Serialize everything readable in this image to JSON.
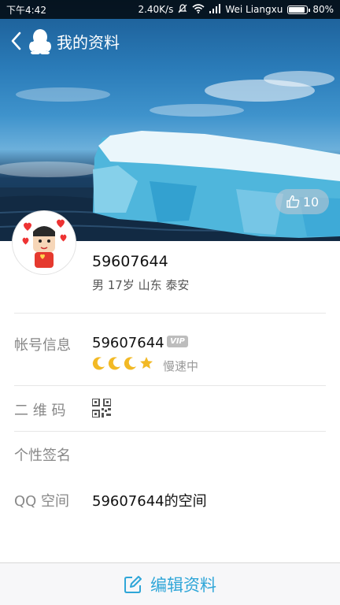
{
  "status_bar": {
    "time": "下午4:42",
    "network_speed": "2.40K/s",
    "carrier": "Wei Liangxu",
    "battery": "80%"
  },
  "header": {
    "title": "我的资料"
  },
  "cover": {
    "like_count": "10"
  },
  "profile": {
    "name": "59607644",
    "info": "男 17岁 山东 泰安"
  },
  "details": {
    "account": {
      "label": "帐号信息",
      "value": "59607644",
      "vip_badge": "VIP",
      "speed": "慢速中"
    },
    "qrcode": {
      "label": "二 维 码"
    },
    "signature": {
      "label": "个性签名",
      "value": ""
    },
    "qzone": {
      "label": "QQ 空间",
      "value": "59607644的空间"
    }
  },
  "bottom": {
    "edit_label": "编辑资料"
  },
  "colors": {
    "accent": "#2fa6d8",
    "label": "#888888",
    "divider": "#e6e6e6"
  }
}
